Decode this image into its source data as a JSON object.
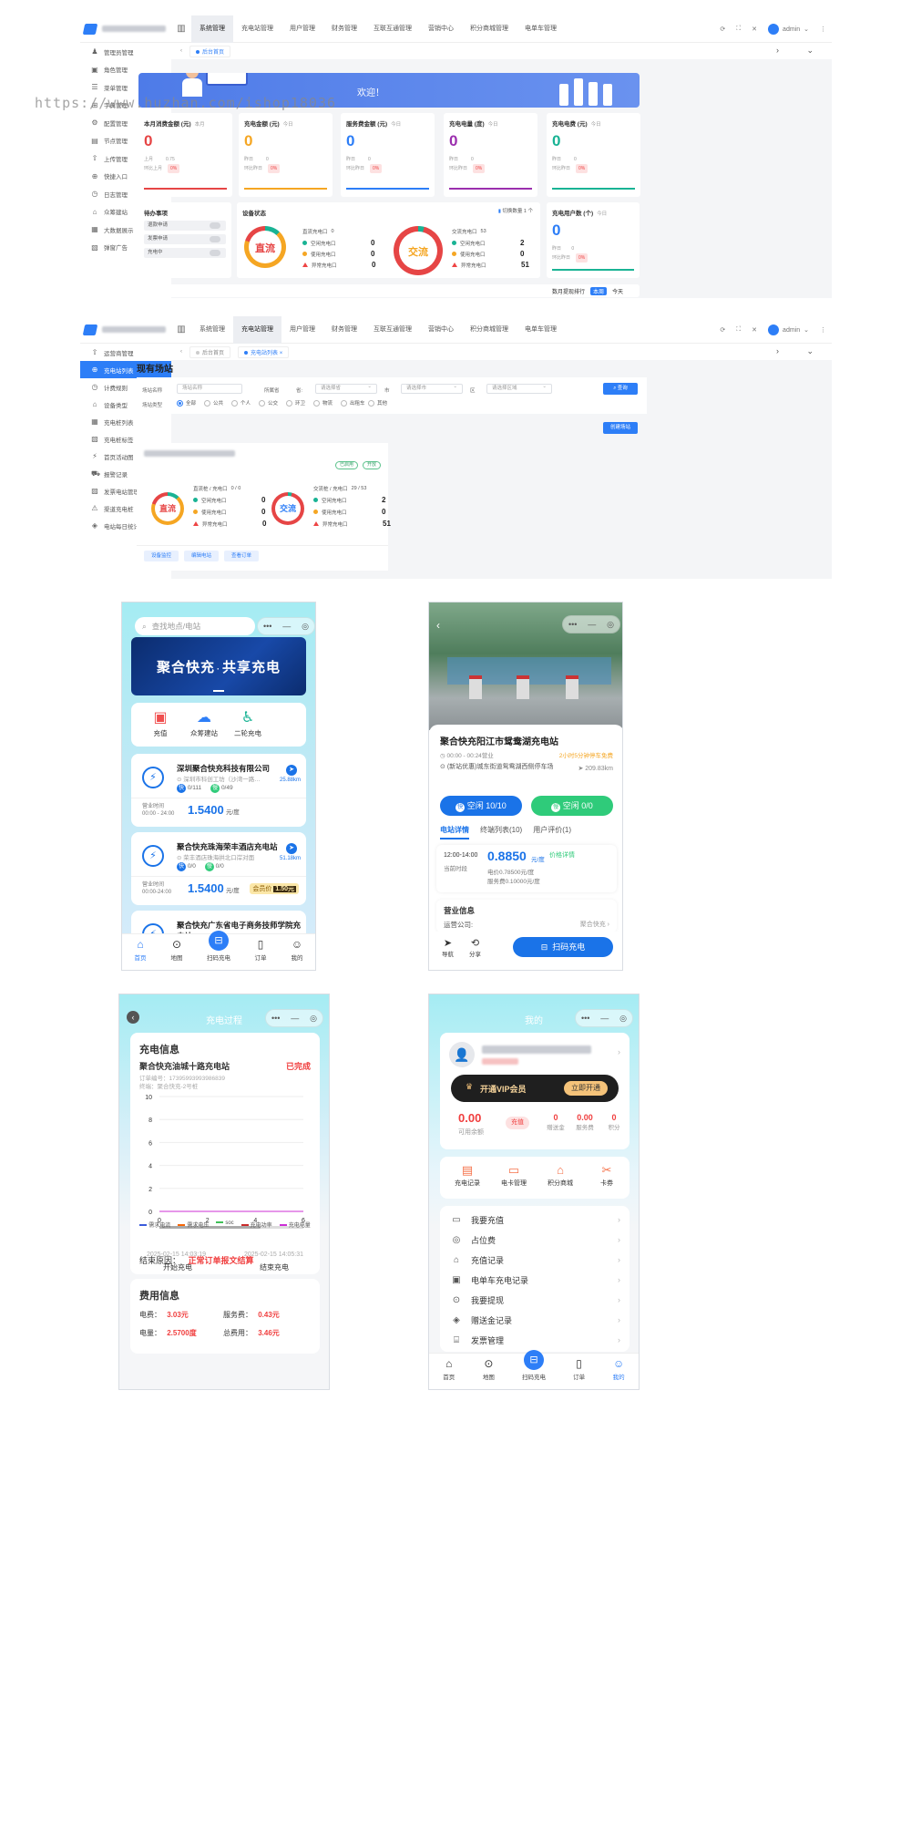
{
  "watermark": "https://www.huzhan.com/ishop18036",
  "admin1": {
    "nav": [
      "系统管理",
      "充电站管理",
      "用户管理",
      "财务管理",
      "互联互通管理",
      "营销中心",
      "积分商城管理",
      "电单车管理"
    ],
    "active_nav": 0,
    "user": "admin",
    "sidebar": [
      "管理员管理",
      "角色管理",
      "菜单管理",
      "字典管理",
      "配置管理",
      "节点管理",
      "上传管理",
      "快捷入口",
      "日志管理",
      "众筹建站",
      "大数据展示",
      "弹窗广告"
    ],
    "crumb": "后台首页",
    "welcome": "欢迎！",
    "stats": [
      {
        "title": "本月消费金额 (元)",
        "tag": "本月",
        "value": "0",
        "color": "#e64545",
        "line1": "上月",
        "line1v": "0.75",
        "line2": "环比上月",
        "badge": "0%",
        "bar": "#e64545"
      },
      {
        "title": "充电金额 (元)",
        "tag": "今日",
        "value": "0",
        "color": "#f5a623",
        "line1": "昨日",
        "line1v": "0",
        "line2": "环比昨日",
        "badge": "0%",
        "extra": "环比昨日",
        "bar": "#f5a623"
      },
      {
        "title": "服务费金额 (元)",
        "tag": "今日",
        "value": "0",
        "color": "#2d7ef7",
        "line1": "昨日",
        "line1v": "0",
        "line2": "环比昨日",
        "badge": "0%",
        "bar": "#2d7ef7"
      },
      {
        "title": "充电电量 (度)",
        "tag": "今日",
        "value": "0",
        "color": "#9b2fae",
        "line1": "昨日",
        "line1v": "0",
        "line2": "环比昨日",
        "badge": "0%",
        "bar": "#9b2fae"
      },
      {
        "title": "充电电费 (元)",
        "tag": "今日",
        "value": "0",
        "color": "#19b394",
        "line1": "昨日",
        "line1v": "0",
        "line2": "环比昨日",
        "badge": "0%",
        "bar": "#19b394"
      }
    ],
    "todo": {
      "title": "待办事项",
      "items": [
        "退款申请",
        "发票申请",
        "充电中"
      ]
    },
    "device": {
      "title": "设备状态",
      "switch": "切换数量 1 个",
      "dc": {
        "label": "直流",
        "head": "直流充电口",
        "count": "0",
        "rows": [
          {
            "name": "空闲充电口",
            "v": "0"
          },
          {
            "name": "使用充电口",
            "v": "0"
          },
          {
            "name": "异常充电口",
            "v": "0"
          }
        ]
      },
      "ac": {
        "label": "交流",
        "head": "交流充电口",
        "count": "53",
        "rows": [
          {
            "name": "空闲充电口",
            "v": "2"
          },
          {
            "name": "使用充电口",
            "v": "0"
          },
          {
            "name": "异常充电口",
            "v": "51"
          }
        ]
      }
    },
    "users_card": {
      "title": "充电用户数 (个)",
      "tag": "今日",
      "value": "0",
      "line1": "昨日",
      "line1v": "0",
      "line2": "环比昨日",
      "badge": "0%"
    },
    "bottom_panel": {
      "title": "数月提现排行",
      "tabs": [
        "本周",
        "今天"
      ]
    }
  },
  "admin2": {
    "nav": [
      "系统管理",
      "充电站管理",
      "用户管理",
      "财务管理",
      "互联互通管理",
      "营销中心",
      "积分商城管理",
      "电单车管理"
    ],
    "active_nav": 1,
    "user": "admin",
    "sidebar": [
      "运营商管理",
      "充电站列表",
      "计费规则",
      "设备类型",
      "充电桩列表",
      "充电桩标签",
      "首页活动图",
      "报警记录",
      "发票电站管理",
      "渠道充电桩",
      "电站每日统计"
    ],
    "active_side": 1,
    "crumbs": [
      "后台首页",
      "充电站列表"
    ],
    "title": "现有场站",
    "filters": {
      "name_label": "场站名称",
      "name_ph": "场站名称",
      "province_label": "所属省",
      "province": "请选择省",
      "city_label": "市",
      "city": "请选择市",
      "district_label": "区",
      "district": "请选择区域",
      "type_label": "场站类型",
      "types": [
        "全部",
        "公共",
        "个人",
        "公交",
        "环卫",
        "物流",
        "出租车",
        "其他"
      ],
      "search": "查询",
      "create": "创建场站"
    },
    "station": {
      "tags": [
        "已启用",
        "开放"
      ],
      "dc": {
        "label": "直流",
        "head": "直流桩 / 充电口",
        "count": "0 / 0",
        "rows": [
          {
            "name": "空闲充电口",
            "v": "0"
          },
          {
            "name": "使用充电口",
            "v": "0"
          },
          {
            "name": "异常充电口",
            "v": "0"
          }
        ]
      },
      "ac": {
        "label": "交流",
        "head": "交流桩 / 充电口",
        "count": "29 / 53",
        "rows": [
          {
            "name": "空闲充电口",
            "v": "2"
          },
          {
            "name": "使用充电口",
            "v": "0"
          },
          {
            "name": "异常充电口",
            "v": "51"
          }
        ]
      },
      "buttons": [
        "设备监控",
        "编辑电站",
        "查看订单"
      ]
    }
  },
  "phone1": {
    "search_ph": "查找地点/电站",
    "banner_title": "聚合快充",
    "banner_dot": "·",
    "banner_title2": "共享充电",
    "quick": [
      "充值",
      "众筹建站",
      "二轮充电"
    ],
    "stations": [
      {
        "name": "深圳聚合快充科技有限公司",
        "addr": "深圳市科创工坊（沙湾一路…",
        "dist": "25.88km",
        "fast": "0/111",
        "slow": "0/49",
        "hours_label": "营业时间",
        "hours": "00:00 - 24:00",
        "price": "1.5400",
        "unit": "元/度"
      },
      {
        "name": "聚合快充珠海荣丰酒店充电站",
        "addr": "荣丰酒店珠海拱北口岸对面",
        "dist": "51.18km",
        "fast": "0/0",
        "slow": "0/0",
        "hours_label": "营业时间",
        "hours": "00:00-24:00",
        "price": "1.5400",
        "unit": "元/度",
        "member_label": "会员价",
        "member": "1.50元"
      },
      {
        "name": "聚合快充广东省电子商务技师学院充电站",
        "addr": "",
        "dist": "",
        "fast": "",
        "slow": "",
        "hours_label": "",
        "hours": "",
        "price": "",
        "unit": ""
      }
    ],
    "tabs": [
      "首页",
      "地图",
      "扫码充电",
      "订单",
      "我的"
    ]
  },
  "phone2": {
    "station_name": "聚合快充阳江市鸳鸯湖充电站",
    "hours": "00:00 - 00:24营业",
    "hours_note": "2小时5分钟停车免费",
    "addr": "(新站优惠)城东街道鸳鸯湖西侧停车场",
    "dist": "209.83km",
    "fast_btn": "空闲 10/10",
    "slow_btn": "空闲 0/0",
    "tabs": [
      "电站详情",
      "终端列表(10)",
      "用户评价(1)"
    ],
    "period": "12:00-14:00",
    "period_label": "当前时段",
    "price": "0.8850",
    "price_unit": "元/度",
    "price_detail": "价格详情",
    "elec": "电价0.78500元/度",
    "service": "服务费0.10000元/度",
    "biz_title": "营业信息",
    "operator_label": "运营公司:",
    "operator": "聚合快充",
    "nav_label": "导航",
    "share_label": "分享",
    "scan_btn": "扫码充电"
  },
  "phone3": {
    "header": "充电过程",
    "info_title": "充电信息",
    "station": "聚合快充油城十路充电站",
    "status": "已完成",
    "order": "订单编号：17395993993986839",
    "terminal": "终端：聚合快充-2号桩",
    "legend": [
      "需求电流",
      "需求电压",
      "soc",
      "充电功率",
      "充电电量"
    ],
    "start_time": "2025-02-15 14:03:19",
    "start_label": "开始充电",
    "end_time": "2025-02-15 14:05:31",
    "end_label": "结束充电",
    "reason_label": "结束原因：",
    "reason": "正常订单报文结算",
    "fee_title": "费用信息",
    "fee": [
      {
        "label": "电费：",
        "v": "3.03元"
      },
      {
        "label": "服务费：",
        "v": "0.43元"
      },
      {
        "label": "电量：",
        "v": "2.5700度"
      },
      {
        "label": "总费用：",
        "v": "3.46元"
      }
    ]
  },
  "chart_data": {
    "type": "line",
    "x": [
      0,
      2,
      4,
      6
    ],
    "xlim": [
      0,
      6
    ],
    "ylim": [
      0,
      10
    ],
    "yticks": [
      0,
      2,
      4,
      6,
      8,
      10
    ],
    "series": [
      {
        "name": "需求电流",
        "values": [
          0,
          0,
          0,
          0
        ],
        "color": "#3b5bdb"
      },
      {
        "name": "需求电压",
        "values": [
          0,
          0,
          0,
          0
        ],
        "color": "#f76707"
      },
      {
        "name": "soc",
        "values": [
          0,
          0,
          0,
          0
        ],
        "color": "#40c057"
      },
      {
        "name": "充电功率",
        "values": [
          0,
          0,
          0,
          0
        ],
        "color": "#c92a2a"
      },
      {
        "name": "充电电量",
        "values": [
          0,
          0,
          0,
          0
        ],
        "color": "#cc2fd6"
      }
    ],
    "grid": true,
    "legend": "bottom"
  },
  "phone4": {
    "header": "我的",
    "vip_label": "开通VIP会员",
    "vip_btn": "立即开通",
    "balance": "0.00",
    "balance_label": "可用余额",
    "recharge": "充值",
    "stats": [
      {
        "v": "0",
        "l": "赠送金"
      },
      {
        "v": "0.00",
        "l": "服务费"
      },
      {
        "v": "0",
        "l": "积分"
      }
    ],
    "grid": [
      "充电记录",
      "电卡管理",
      "积分商城",
      "卡券"
    ],
    "menu": [
      "我要充值",
      "占位费",
      "充值记录",
      "电单车充电记录",
      "我要提现",
      "赠送金记录",
      "发票管理"
    ],
    "tabs": [
      "首页",
      "地图",
      "扫码充电",
      "订单",
      "我的"
    ]
  }
}
